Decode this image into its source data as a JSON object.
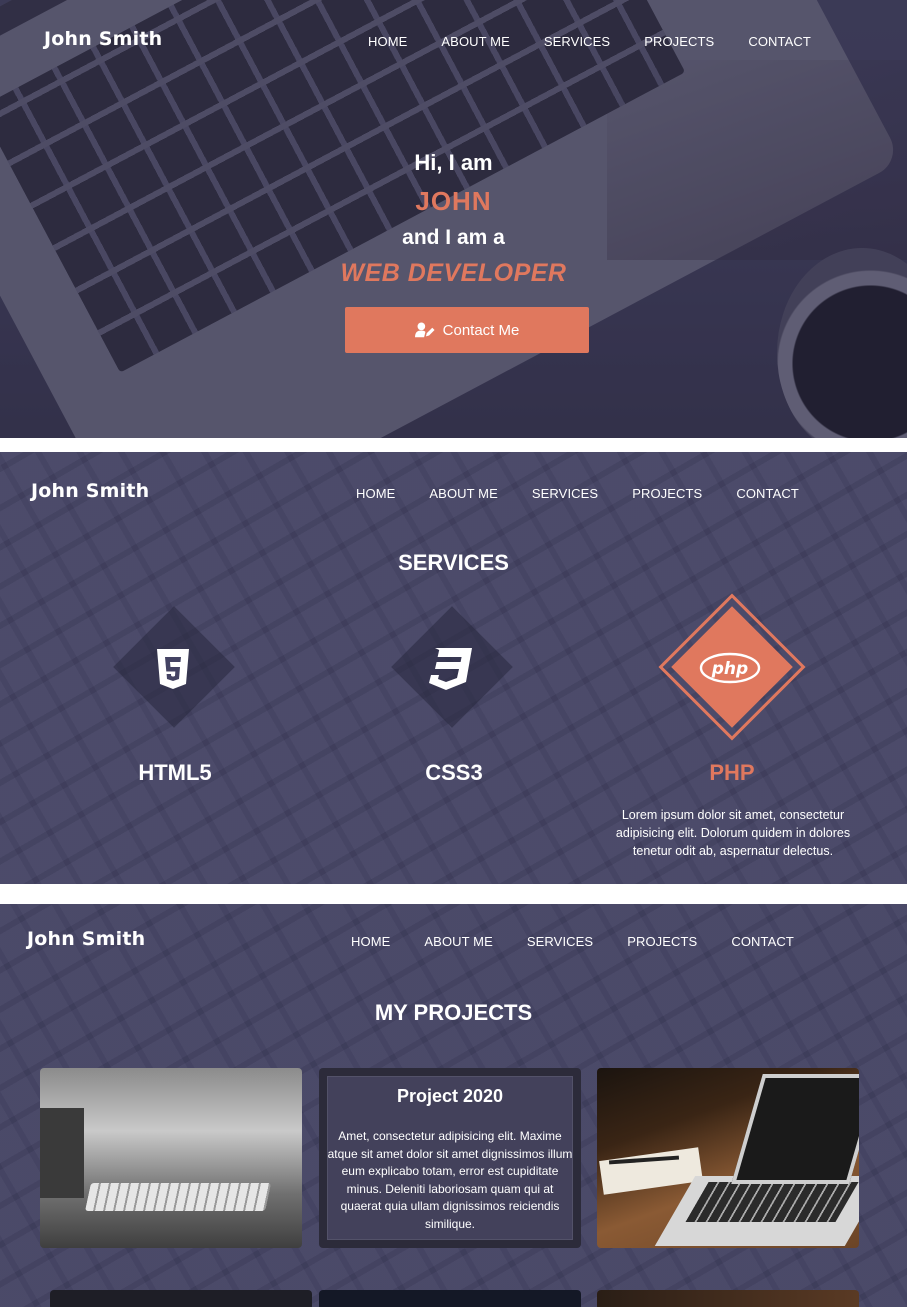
{
  "nav": {
    "brand": "John Smith",
    "items": [
      "HOME",
      "ABOUT ME",
      "SERVICES",
      "PROJECTS",
      "CONTACT"
    ]
  },
  "hero": {
    "line1": "Hi, I am",
    "name": "JOHN",
    "line2": "and I am a",
    "role": "WEB DEVELOPER",
    "button_label": "Contact Me",
    "button_icon": "user-edit-icon"
  },
  "services": {
    "title": "SERVICES",
    "items": [
      {
        "name": "HTML5",
        "icon": "html5-icon"
      },
      {
        "name": "CSS3",
        "icon": "css3-icon"
      },
      {
        "name": "PHP",
        "icon": "php-icon",
        "description": "Lorem ipsum dolor sit amet, consectetur adipisicing elit. Dolorum quidem in dolores tenetur odit ab, aspernatur delectus."
      }
    ]
  },
  "projects": {
    "title": "MY PROJECTS",
    "featured_title": "Project 2020",
    "featured_description": "Amet, consectetur adipisicing elit. Maxime atque sit amet dolor sit amet dignissimos illum eum explicabo totam, error est cupiditate minus. Deleniti laboriosam quam qui at quaerat quia ullam dignissimos reiciendis similique."
  },
  "colors": {
    "accent": "#e0785e",
    "background": "#444363"
  }
}
